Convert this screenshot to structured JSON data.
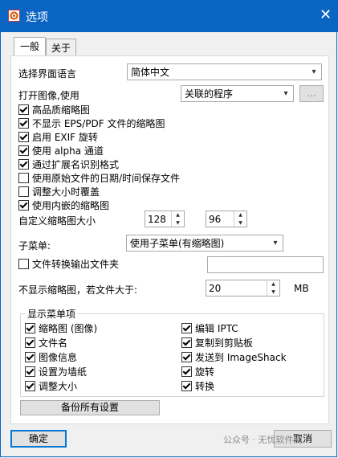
{
  "window": {
    "title": "选项",
    "close": "✕"
  },
  "tabs": [
    {
      "label": "一般"
    },
    {
      "label": "关于"
    }
  ],
  "general": {
    "language_label": "选择界面语言",
    "language_value": "简体中文",
    "open_image_label": "打开图像,使用",
    "open_image_value": "关联的程序",
    "browse_label": "...",
    "checkboxes": [
      {
        "label": "高品质缩略图",
        "checked": true
      },
      {
        "label": "不显示 EPS/PDF 文件的缩略图",
        "checked": true
      },
      {
        "label": "启用 EXIF 旋转",
        "checked": true
      },
      {
        "label": "使用 alpha 通道",
        "checked": true
      },
      {
        "label": "通过扩展名识别格式",
        "checked": true
      },
      {
        "label": "使用原始文件的日期/时间保存文件",
        "checked": false
      },
      {
        "label": "调整大小时覆盖",
        "checked": false
      },
      {
        "label": "使用内嵌的缩略图",
        "checked": true
      }
    ],
    "thumb_size_label": "自定义缩略图大小",
    "thumb_width": "128",
    "thumb_height": "96",
    "submenu_label": "子菜单:",
    "submenu_value": "使用子菜单(有缩略图)",
    "convert_output_label": "文件转换输出文件夹",
    "convert_output_checked": false,
    "convert_output_value": "",
    "no_thumb_label": "不显示缩略图，若文件大于:",
    "no_thumb_value": "20",
    "no_thumb_unit": "MB",
    "menu_items_legend": "显示菜单项",
    "menu_items_left": [
      {
        "label": "缩略图 (图像)",
        "checked": true
      },
      {
        "label": "文件名",
        "checked": true
      },
      {
        "label": "图像信息",
        "checked": true
      },
      {
        "label": "设置为墙纸",
        "checked": true
      },
      {
        "label": "调整大小",
        "checked": true
      }
    ],
    "menu_items_right": [
      {
        "label": "编辑 IPTC",
        "checked": true
      },
      {
        "label": "复制到剪贴板",
        "checked": true
      },
      {
        "label": "发送到 ImageShack",
        "checked": true
      },
      {
        "label": "旋转",
        "checked": true
      },
      {
        "label": "转换",
        "checked": true
      }
    ],
    "backup_label": "备份所有设置"
  },
  "footer": {
    "ok_label": "确定",
    "cancel_label": "取消"
  },
  "watermark": "公众号 · 无忧软件网",
  "colors": {
    "titlebar": "#0a64c2",
    "accent": "#0078d7"
  }
}
